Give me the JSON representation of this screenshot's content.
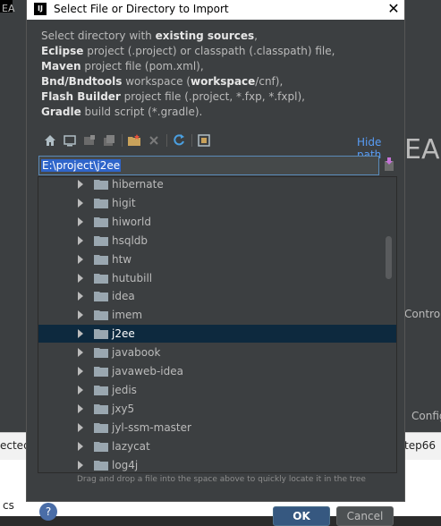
{
  "background": {
    "ide_title": "EA",
    "right_label_1": "Control",
    "right_label_2": "Config",
    "bottom_left_text": "ected",
    "bottom_right_text": "tep66",
    "bottom_row_text": "cs",
    "help_label": "?",
    "ok_label": "OK",
    "cancel_label": "Cancel"
  },
  "dialog": {
    "title": "Select File or Directory to Import",
    "title_icon_label": "IJ",
    "close_label": "✕",
    "description": {
      "line1_prefix": "Select directory with ",
      "line1_bold": "existing sources",
      "line1_suffix": ",",
      "line2_bold": "Eclipse",
      "line2_rest": " project (.project) or classpath (.classpath) file,",
      "line3_bold": "Maven",
      "line3_rest": " project file (pom.xml),",
      "line4_bold": "Bnd/Bndtools",
      "line4_mid": " workspace (",
      "line4_bold2": "workspace",
      "line4_rest": "/cnf),",
      "line5_bold": "Flash Builder",
      "line5_rest": " project file (.project, *.fxp, *.fxpl),",
      "line6_bold": "Gradle",
      "line6_rest": " build script (*.gradle)."
    },
    "hide_path_label": "Hide path",
    "path_value": "E:\\project\\j2ee",
    "tree": {
      "items": [
        {
          "name": "hibernate",
          "selected": false
        },
        {
          "name": "higit",
          "selected": false
        },
        {
          "name": "hiworld",
          "selected": false
        },
        {
          "name": "hsqldb",
          "selected": false
        },
        {
          "name": "htw",
          "selected": false
        },
        {
          "name": "hutubill",
          "selected": false
        },
        {
          "name": "idea",
          "selected": false
        },
        {
          "name": "imem",
          "selected": false
        },
        {
          "name": "j2ee",
          "selected": true
        },
        {
          "name": "javabook",
          "selected": false
        },
        {
          "name": "javaweb-idea",
          "selected": false
        },
        {
          "name": "jedis",
          "selected": false
        },
        {
          "name": "jxy5",
          "selected": false
        },
        {
          "name": "jyl-ssm-master",
          "selected": false
        },
        {
          "name": "lazycat",
          "selected": false
        },
        {
          "name": "log4j",
          "selected": false
        }
      ]
    },
    "hint": "Drag and drop a file into the space above to quickly locate it in the tree"
  },
  "colors": {
    "accent_link": "#589df6",
    "selection": "#0d293e",
    "path_highlight": "#2f65ca"
  }
}
